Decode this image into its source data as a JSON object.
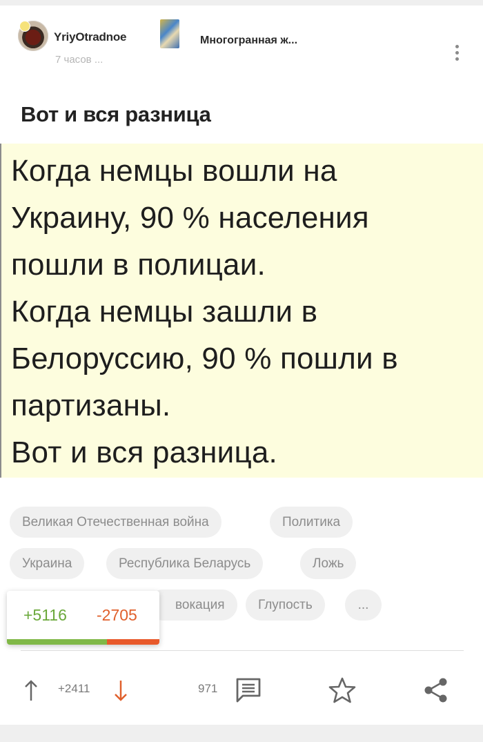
{
  "post": {
    "author": "YriyOtradnoe",
    "time": "7 часов ...",
    "community": "Многогранная ж...",
    "title": "Вот и вся разница",
    "image_text": "Когда немцы вошли на\nУкраину, 90 % населения\nпошли в полицаи.\nКогда немцы зашли в\nБелоруссию, 90 % пошли в\nпартизаны.\nВот и вся разница."
  },
  "tags": [
    "Великая Отечественная война",
    "Политика",
    "Украина",
    "Республика Беларусь",
    "Ложь",
    "вокация",
    "Глупость",
    "..."
  ],
  "rating": {
    "plus": "+5116",
    "minus": "-2705",
    "plus_fraction": 0.654
  },
  "footer": {
    "upvotes": "+2411",
    "comments": "971"
  },
  "colors": {
    "plus": "#6aa83a",
    "minus": "#e0602c",
    "meme_bg": "#fdfdde"
  },
  "icons": [
    "more-vertical-icon",
    "arrow-up-icon",
    "arrow-down-icon",
    "comment-icon",
    "star-icon",
    "share-icon"
  ]
}
